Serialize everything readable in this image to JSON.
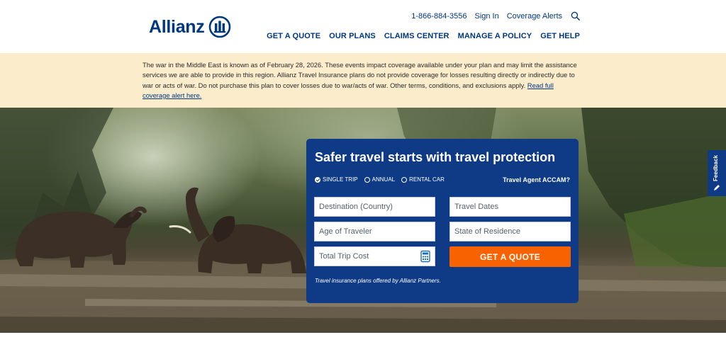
{
  "brand": {
    "logo_text": "Allianz",
    "primary_color": "#003781",
    "accent_color": "#f86200"
  },
  "utility_nav": {
    "phone": "1-866-884-3556",
    "sign_in": "Sign In",
    "coverage_alerts": "Coverage Alerts",
    "search_icon": "search-icon"
  },
  "main_nav": [
    "GET A QUOTE",
    "OUR PLANS",
    "CLAIMS CENTER",
    "MANAGE A POLICY",
    "GET HELP"
  ],
  "alert": {
    "text": "The war in the Middle East is known as of February 28, 2026. These events impact coverage available under your plan and may limit the assistance services we are able to provide in this region. Allianz Travel Insurance plans do not provide coverage for losses resulting directly or indirectly due to war or acts of war. Do not purchase this plan to cover losses due to war/acts of war. Other terms, conditions, and exclusions apply.",
    "link": "Read full coverage alert here."
  },
  "quote_form": {
    "title": "Safer travel starts with travel protection",
    "trip_types": [
      {
        "label": "SINGLE TRIP",
        "selected": true
      },
      {
        "label": "ANNUAL",
        "selected": false
      },
      {
        "label": "RENTAL CAR",
        "selected": false
      }
    ],
    "agent_link": "Travel Agent ACCAM?",
    "fields": {
      "destination": "Destination (Country)",
      "travel_dates": "Travel Dates",
      "age": "Age of Traveler",
      "state": "State of Residence",
      "trip_cost": "Total Trip Cost"
    },
    "cta": "GET A QUOTE",
    "disclaimer": "Travel insurance plans offered by Allianz Partners."
  },
  "feedback": {
    "label": "Feedback"
  }
}
